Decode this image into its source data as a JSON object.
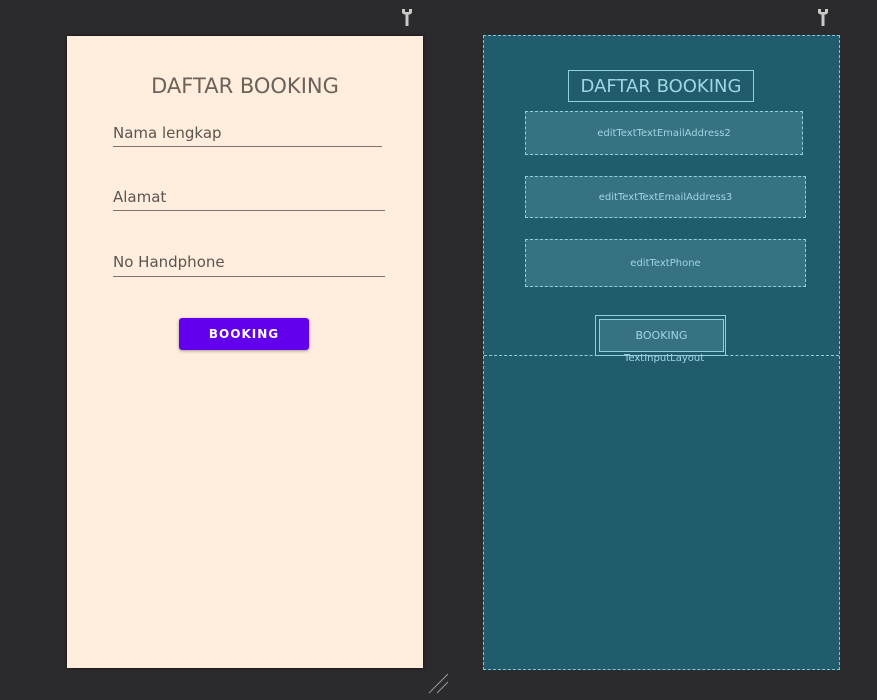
{
  "design": {
    "title": "DAFTAR BOOKING",
    "fields": [
      {
        "text": "Nama lengkap"
      },
      {
        "text": "Alamat"
      },
      {
        "text": "No Handphone"
      }
    ],
    "button": "BOOKING"
  },
  "blueprint": {
    "title": "DAFTAR BOOKING",
    "fields": [
      "editTextTextEmailAddress2",
      "editTextTextEmailAddress3",
      "editTextPhone"
    ],
    "button": "BOOKING",
    "layout_label": "TextInputLayout"
  },
  "icons": [
    "wrench-icon",
    "resize-handle-icon"
  ],
  "colors": {
    "canvas": "#2b2b2d",
    "design_bg": "#ffeddd",
    "accent": "#6200ee",
    "blueprint_bg": "#215c6c",
    "blueprint_line": "#8fd0df"
  }
}
